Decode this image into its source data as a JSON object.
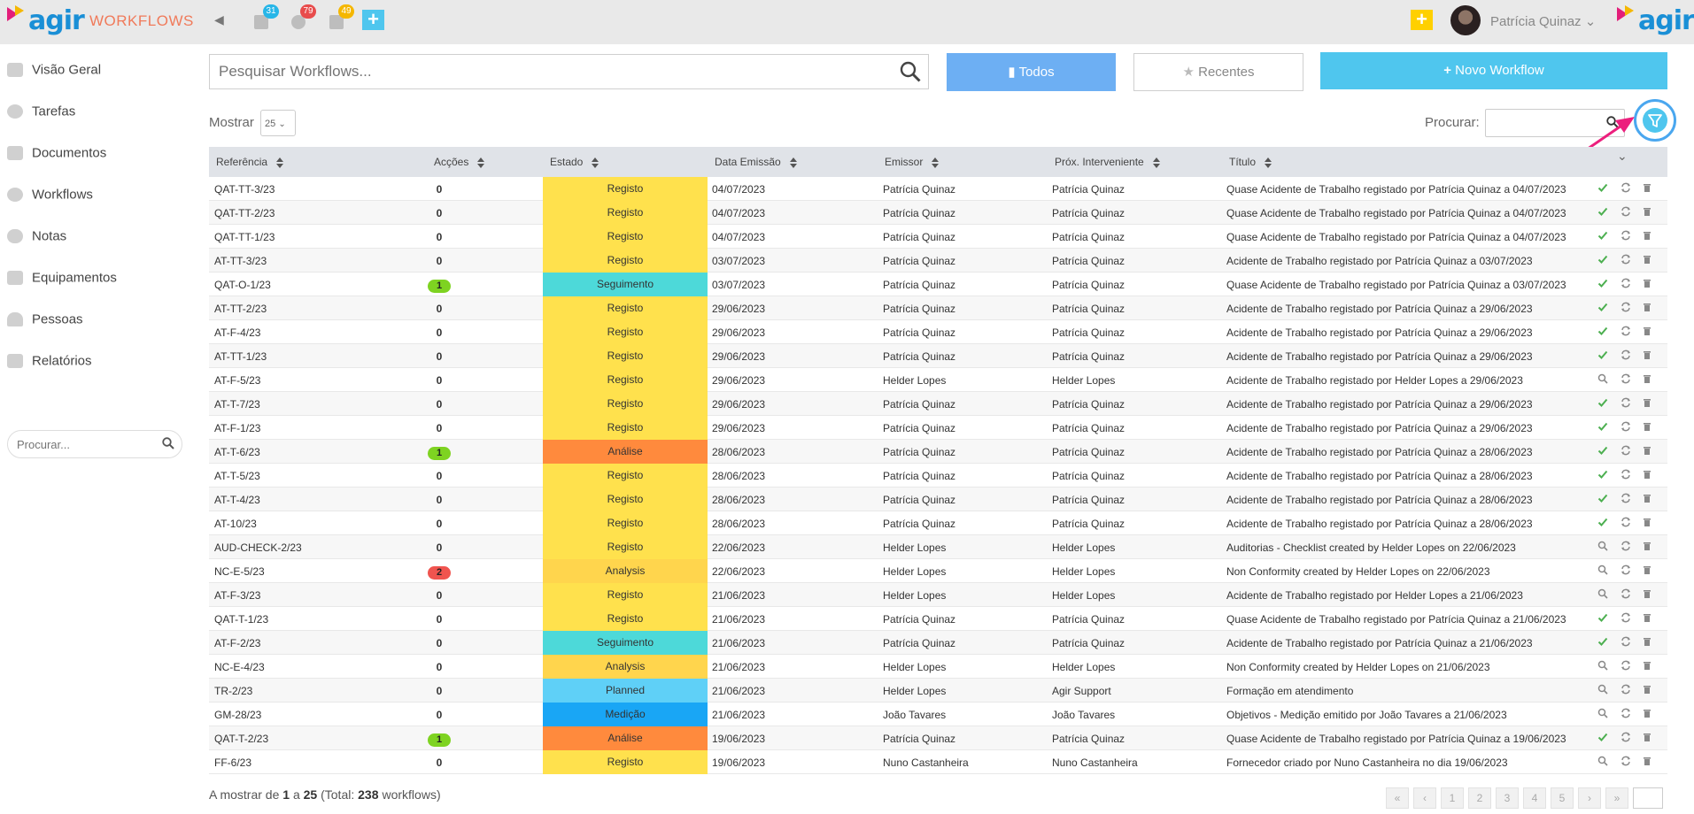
{
  "header": {
    "logo_text": "agir",
    "app_title": "WORKFLOWS",
    "badges": [
      {
        "name": "calendar",
        "count": "31",
        "color": "#27b6e8"
      },
      {
        "name": "gear",
        "count": "79",
        "color": "#e84c4c"
      },
      {
        "name": "document",
        "count": "49",
        "color": "#f5b700"
      }
    ],
    "user_name": "Patrícia Quinaz",
    "right_logo_text": "agir"
  },
  "sidebar": {
    "items": [
      {
        "label": "Visão Geral",
        "icon": "home-icon"
      },
      {
        "label": "Tarefas",
        "icon": "gear-icon"
      },
      {
        "label": "Documentos",
        "icon": "document-icon"
      },
      {
        "label": "Workflows",
        "icon": "cogs-icon"
      },
      {
        "label": "Notas",
        "icon": "comments-icon"
      },
      {
        "label": "Equipamentos",
        "icon": "wrench-icon"
      },
      {
        "label": "Pessoas",
        "icon": "person-icon"
      },
      {
        "label": "Relatórios",
        "icon": "table-icon"
      }
    ],
    "search_placeholder": "Procurar..."
  },
  "toolbar": {
    "search_placeholder": "Pesquisar Workflows...",
    "todos_label": "Todos",
    "recentes_label": "Recentes",
    "novo_label": "Novo Workflow"
  },
  "table_controls": {
    "mostrar_label": "Mostrar",
    "mostrar_value": "25",
    "procurar_label": "Procurar:"
  },
  "columns": [
    "Referência",
    "Acções",
    "Estado",
    "Data Emissão",
    "Emissor",
    "Próx. Interveniente",
    "Título"
  ],
  "status_colors": {
    "Registo": "#ffe14d",
    "Seguimento": "#4dd9d9",
    "Análise": "#ff8a3d",
    "Analysis": "#ffd54d",
    "Planned": "#5fd0f7",
    "Medição": "#19a6f5"
  },
  "rows": [
    {
      "ref": "QAT-TT-3/23",
      "acc": "0",
      "estado": "Registo",
      "data": "04/07/2023",
      "emissor": "Patrícia Quinaz",
      "prox": "Patrícia Quinaz",
      "titulo": "Quase Acidente de Trabalho registado por Patrícia Quinaz a 04/07/2023",
      "first_action": "check"
    },
    {
      "ref": "QAT-TT-2/23",
      "acc": "0",
      "estado": "Registo",
      "data": "04/07/2023",
      "emissor": "Patrícia Quinaz",
      "prox": "Patrícia Quinaz",
      "titulo": "Quase Acidente de Trabalho registado por Patrícia Quinaz a 04/07/2023",
      "first_action": "check"
    },
    {
      "ref": "QAT-TT-1/23",
      "acc": "0",
      "estado": "Registo",
      "data": "04/07/2023",
      "emissor": "Patrícia Quinaz",
      "prox": "Patrícia Quinaz",
      "titulo": "Quase Acidente de Trabalho registado por Patrícia Quinaz a 04/07/2023",
      "first_action": "check"
    },
    {
      "ref": "AT-TT-3/23",
      "acc": "0",
      "estado": "Registo",
      "data": "03/07/2023",
      "emissor": "Patrícia Quinaz",
      "prox": "Patrícia Quinaz",
      "titulo": "Acidente de Trabalho registado por Patrícia Quinaz a 03/07/2023",
      "first_action": "check"
    },
    {
      "ref": "QAT-O-1/23",
      "acc": "1",
      "acc_color": "#7ed321",
      "estado": "Seguimento",
      "data": "03/07/2023",
      "emissor": "Patrícia Quinaz",
      "prox": "Patrícia Quinaz",
      "titulo": "Quase Acidente de Trabalho registado por Patrícia Quinaz a 03/07/2023",
      "first_action": "check"
    },
    {
      "ref": "AT-TT-2/23",
      "acc": "0",
      "estado": "Registo",
      "data": "29/06/2023",
      "emissor": "Patrícia Quinaz",
      "prox": "Patrícia Quinaz",
      "titulo": "Acidente de Trabalho registado por Patrícia Quinaz a 29/06/2023",
      "first_action": "check"
    },
    {
      "ref": "AT-F-4/23",
      "acc": "0",
      "estado": "Registo",
      "data": "29/06/2023",
      "emissor": "Patrícia Quinaz",
      "prox": "Patrícia Quinaz",
      "titulo": "Acidente de Trabalho registado por Patrícia Quinaz a 29/06/2023",
      "first_action": "check"
    },
    {
      "ref": "AT-TT-1/23",
      "acc": "0",
      "estado": "Registo",
      "data": "29/06/2023",
      "emissor": "Patrícia Quinaz",
      "prox": "Patrícia Quinaz",
      "titulo": "Acidente de Trabalho registado por Patrícia Quinaz a 29/06/2023",
      "first_action": "check"
    },
    {
      "ref": "AT-F-5/23",
      "acc": "0",
      "estado": "Registo",
      "data": "29/06/2023",
      "emissor": "Helder Lopes",
      "prox": "Helder Lopes",
      "titulo": "Acidente de Trabalho registado por Helder Lopes a 29/06/2023",
      "first_action": "search"
    },
    {
      "ref": "AT-T-7/23",
      "acc": "0",
      "estado": "Registo",
      "data": "29/06/2023",
      "emissor": "Patrícia Quinaz",
      "prox": "Patrícia Quinaz",
      "titulo": "Acidente de Trabalho registado por Patrícia Quinaz a 29/06/2023",
      "first_action": "check"
    },
    {
      "ref": "AT-F-1/23",
      "acc": "0",
      "estado": "Registo",
      "data": "29/06/2023",
      "emissor": "Patrícia Quinaz",
      "prox": "Patrícia Quinaz",
      "titulo": "Acidente de Trabalho registado por Patrícia Quinaz a 29/06/2023",
      "first_action": "check"
    },
    {
      "ref": "AT-T-6/23",
      "acc": "1",
      "acc_color": "#7ed321",
      "estado": "Análise",
      "data": "28/06/2023",
      "emissor": "Patrícia Quinaz",
      "prox": "Patrícia Quinaz",
      "titulo": "Acidente de Trabalho registado por Patrícia Quinaz a 28/06/2023",
      "first_action": "check"
    },
    {
      "ref": "AT-T-5/23",
      "acc": "0",
      "estado": "Registo",
      "data": "28/06/2023",
      "emissor": "Patrícia Quinaz",
      "prox": "Patrícia Quinaz",
      "titulo": "Acidente de Trabalho registado por Patrícia Quinaz a 28/06/2023",
      "first_action": "check"
    },
    {
      "ref": "AT-T-4/23",
      "acc": "0",
      "estado": "Registo",
      "data": "28/06/2023",
      "emissor": "Patrícia Quinaz",
      "prox": "Patrícia Quinaz",
      "titulo": "Acidente de Trabalho registado por Patrícia Quinaz a 28/06/2023",
      "first_action": "check"
    },
    {
      "ref": "AT-10/23",
      "acc": "0",
      "estado": "Registo",
      "data": "28/06/2023",
      "emissor": "Patrícia Quinaz",
      "prox": "Patrícia Quinaz",
      "titulo": "Acidente de Trabalho registado por Patrícia Quinaz a 28/06/2023",
      "first_action": "check"
    },
    {
      "ref": "AUD-CHECK-2/23",
      "acc": "0",
      "estado": "Registo",
      "data": "22/06/2023",
      "emissor": "Helder Lopes",
      "prox": "Helder Lopes",
      "titulo": "Auditorias - Checklist created by Helder Lopes on 22/06/2023",
      "first_action": "search"
    },
    {
      "ref": "NC-E-5/23",
      "acc": "2",
      "acc_color": "#f0544f",
      "estado": "Analysis",
      "data": "22/06/2023",
      "emissor": "Helder Lopes",
      "prox": "Helder Lopes",
      "titulo": "Non Conformity created by Helder Lopes on 22/06/2023",
      "first_action": "search"
    },
    {
      "ref": "AT-F-3/23",
      "acc": "0",
      "estado": "Registo",
      "data": "21/06/2023",
      "emissor": "Helder Lopes",
      "prox": "Helder Lopes",
      "titulo": "Acidente de Trabalho registado por Helder Lopes a 21/06/2023",
      "first_action": "search"
    },
    {
      "ref": "QAT-T-1/23",
      "acc": "0",
      "estado": "Registo",
      "data": "21/06/2023",
      "emissor": "Patrícia Quinaz",
      "prox": "Patrícia Quinaz",
      "titulo": "Quase Acidente de Trabalho registado por Patrícia Quinaz a 21/06/2023",
      "first_action": "check"
    },
    {
      "ref": "AT-F-2/23",
      "acc": "0",
      "estado": "Seguimento",
      "data": "21/06/2023",
      "emissor": "Patrícia Quinaz",
      "prox": "Patrícia Quinaz",
      "titulo": "Acidente de Trabalho registado por Patrícia Quinaz a 21/06/2023",
      "first_action": "check"
    },
    {
      "ref": "NC-E-4/23",
      "acc": "0",
      "estado": "Analysis",
      "data": "21/06/2023",
      "emissor": "Helder Lopes",
      "prox": "Helder Lopes",
      "titulo": "Non Conformity created by Helder Lopes on 21/06/2023",
      "first_action": "search"
    },
    {
      "ref": "TR-2/23",
      "acc": "0",
      "estado": "Planned",
      "data": "21/06/2023",
      "emissor": "Helder Lopes",
      "prox": "Agir Support",
      "titulo": "Formação em atendimento",
      "first_action": "search"
    },
    {
      "ref": "GM-28/23",
      "acc": "0",
      "estado": "Medição",
      "data": "21/06/2023",
      "emissor": "João Tavares",
      "prox": "João Tavares",
      "titulo": "Objetivos - Medição emitido por João Tavares a 21/06/2023",
      "first_action": "search"
    },
    {
      "ref": "QAT-T-2/23",
      "acc": "1",
      "acc_color": "#7ed321",
      "estado": "Análise",
      "data": "19/06/2023",
      "emissor": "Patrícia Quinaz",
      "prox": "Patrícia Quinaz",
      "titulo": "Quase Acidente de Trabalho registado por Patrícia Quinaz a 19/06/2023",
      "first_action": "check"
    },
    {
      "ref": "FF-6/23",
      "acc": "0",
      "estado": "Registo",
      "data": "19/06/2023",
      "emissor": "Nuno Castanheira",
      "prox": "Nuno Castanheira",
      "titulo": "Fornecedor criado por Nuno Castanheira no dia 19/06/2023",
      "first_action": "search"
    }
  ],
  "footer": {
    "prefix": "A mostrar de",
    "from": "1",
    "to_word": "a",
    "to": "25",
    "total_prefix": "(Total:",
    "total": "238",
    "total_suffix": "workflows)"
  },
  "pagination": [
    "«",
    "‹",
    "1",
    "2",
    "3",
    "4",
    "5",
    "›",
    "»",
    ""
  ]
}
